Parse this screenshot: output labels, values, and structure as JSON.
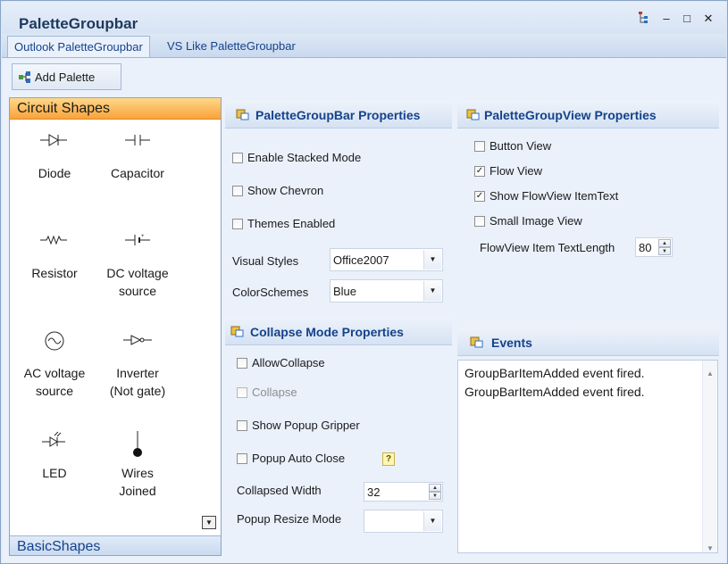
{
  "window": {
    "title": "PaletteGroupbar",
    "controls": {
      "minimize": "–",
      "maximize": "□",
      "close": "✕"
    }
  },
  "tabs": [
    {
      "label": "Outlook PaletteGroupbar",
      "active": true
    },
    {
      "label": "VS Like PaletteGroupbar",
      "active": false
    }
  ],
  "toolbar": {
    "add_palette_label": "Add Palette"
  },
  "palette": {
    "header": "Circuit Shapes",
    "footer": "BasicShapes",
    "items": [
      {
        "icon": "diode-icon",
        "line1": "Diode",
        "line2": ""
      },
      {
        "icon": "capacitor-icon",
        "line1": "Capacitor",
        "line2": ""
      },
      {
        "icon": "resistor-icon",
        "line1": "Resistor",
        "line2": ""
      },
      {
        "icon": "dc-voltage-source-icon",
        "line1": "DC voltage",
        "line2": "source"
      },
      {
        "icon": "ac-voltage-source-icon",
        "line1": "AC voltage",
        "line2": "source"
      },
      {
        "icon": "inverter-icon",
        "line1": "Inverter",
        "line2": "(Not gate)"
      },
      {
        "icon": "led-icon",
        "line1": "LED",
        "line2": ""
      },
      {
        "icon": "wires-joined-icon",
        "line1": "Wires",
        "line2": "Joined"
      }
    ]
  },
  "groupbar_props": {
    "title": "PaletteGroupBar Properties",
    "enable_stacked": {
      "label": "Enable Stacked Mode",
      "checked": false
    },
    "show_chevron": {
      "label": "Show Chevron",
      "checked": false
    },
    "themes_enabled": {
      "label": "Themes Enabled",
      "checked": false
    },
    "visual_styles": {
      "label": "Visual Styles",
      "value": "Office2007"
    },
    "color_schemes": {
      "label": "ColorSchemes",
      "value": "Blue"
    }
  },
  "groupview_props": {
    "title": "PaletteGroupView Properties",
    "button_view": {
      "label": "Button View",
      "checked": false
    },
    "flow_view": {
      "label": "Flow View",
      "checked": true
    },
    "show_flowview_text": {
      "label": "Show FlowView ItemText",
      "checked": true
    },
    "small_image_view": {
      "label": "Small Image View",
      "checked": false
    },
    "text_length": {
      "label": "FlowView Item TextLength",
      "value": "80"
    }
  },
  "collapse_props": {
    "title": "Collapse Mode Properties",
    "allow_collapse": {
      "label": "AllowCollapse",
      "checked": false
    },
    "collapse": {
      "label": "Collapse",
      "checked": false
    },
    "show_popup_gripper": {
      "label": "Show Popup Gripper",
      "checked": false
    },
    "popup_auto_close": {
      "label": "Popup Auto Close",
      "checked": false
    },
    "collapsed_width": {
      "label": "Collapsed Width",
      "value": "32"
    },
    "popup_resize_mode": {
      "label": "Popup Resize Mode",
      "value": ""
    }
  },
  "events": {
    "title": "Events",
    "lines": [
      "GroupBarItemAdded event fired.",
      "GroupBarItemAdded event fired."
    ]
  },
  "colors": {
    "accent": "#15428b",
    "palette_header": "#f9a23a",
    "panel_bg": "#eaf1fb"
  }
}
